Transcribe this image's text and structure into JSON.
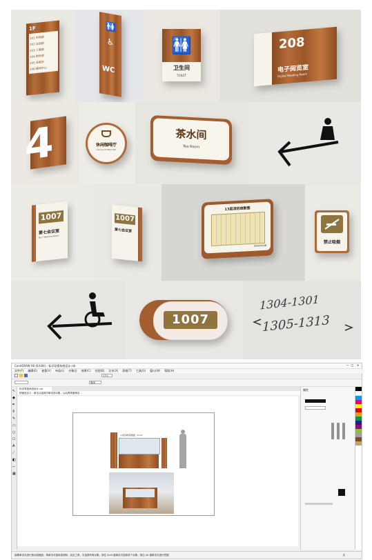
{
  "signs": {
    "directory_rows": [
      "101 市场部",
      "102 企划部",
      "103 人事部",
      "104 财务部",
      "105 总经办",
      "106 接待中心"
    ],
    "directory_floor": "1F",
    "wc_label": "WC",
    "toilet_cn": "卫生间",
    "toilet_en": "TOILET",
    "room_number": "208",
    "room_cn": "电子阅览室",
    "room_en": "Digital Reading Room",
    "floor_number": "4",
    "cafe_cn": "休闲咖啡厅",
    "cafe_en": "Leisure Coffee Hall",
    "tea_cn": "茶水间",
    "tea_en": "Tea Room",
    "meeting_number": "1007",
    "meeting_cn": "第七会议室",
    "meeting_en": "No.7 Meeting Room",
    "map_title": "13层消防疏散图",
    "map_footer": "您所在的位置",
    "nosmoke_cn": "禁止吸烟",
    "oval_number": "1007",
    "range_top": "1304-1301",
    "range_bottom": "1305-1313"
  },
  "app": {
    "title": "CorelDRAW X8 (64-Bit) - 标识导视系统设计.cdr",
    "menu": [
      "文件(F)",
      "编辑(E)",
      "查看(V)",
      "布局(L)",
      "对象(J)",
      "效果(C)",
      "位图(B)",
      "文本(X)",
      "表格(T)",
      "工具(O)",
      "窗口(W)",
      "帮助(H)"
    ],
    "zoom": "17%",
    "unit": "毫米",
    "tab": "标识导视系统设计.cdr",
    "status_left": "接着单击可进行拖动或缩放；再单击可旋转或倾斜；双击工具，可选择所有对象；按住 Shift 键单击可选择多个对象；按住 Alt 键单击可进行挖掘",
    "status_right": "无",
    "panel_title": "属性",
    "drawing_title": "13层消防疏散图 · PLAN",
    "info_line": "快速自定义  · 单击以选择可单击的对象，以后再快速单击…",
    "ruler_mark": "无"
  }
}
